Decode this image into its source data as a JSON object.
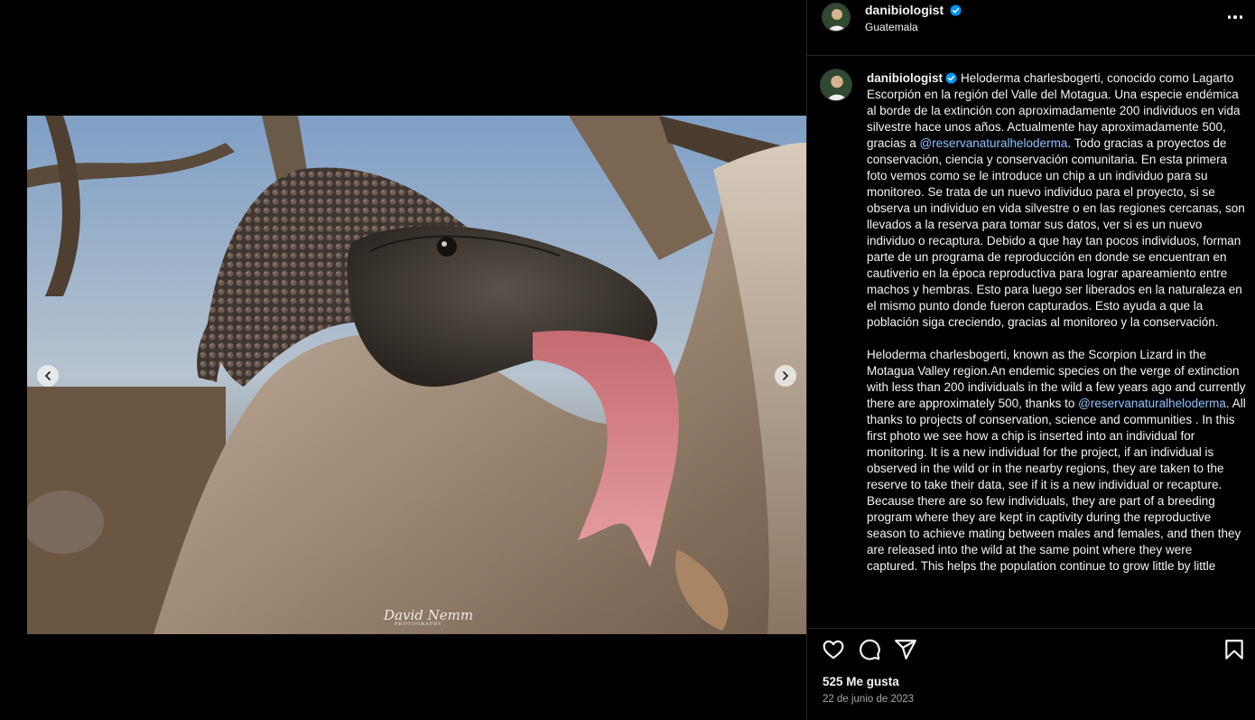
{
  "post": {
    "username": "danibiologist",
    "location": "Guatemala",
    "caption_es_1": "Heloderma charlesbogerti, conocido como Lagarto Escorpión en la región del Valle del Motagua. Una especie endémica al borde de la extinción con aproximadamente 200 individuos en vida silvestre hace unos años. Actualmente hay aproximadamente 500, gracias a ",
    "mention": "@reservanaturalheloderma",
    "caption_es_2": ". Todo gracias a proyectos de conservación, ciencia y conservación comunitaria. En esta primera foto vemos como se le introduce un chip a un individuo para su monitoreo. Se trata de un nuevo individuo para el proyecto, si se observa un individuo en vida silvestre o en las regiones cercanas, son llevados a la reserva para tomar sus datos, ver si es un nuevo individuo o recaptura. Debido a que hay tan pocos individuos, forman parte de un programa de reproducción en donde se encuentran en cautiverio en la época reproductiva para lograr apareamiento entre machos y hembras. Esto para luego ser liberados en la naturaleza en el mismo punto donde fueron capturados. Esto ayuda a que la población siga creciendo, gracias al monitoreo y la conservación.",
    "caption_en_1": "Heloderma charlesbogerti, known as the Scorpion Lizard in the Motagua Valley region.An endemic species on the verge of extinction with less than 200 individuals in the wild a few years ago and currently there are approximately 500, thanks to ",
    "caption_en_2": ". All thanks to projects of conservation, science and communities . In this first photo we see how a chip is inserted into an individual for monitoring. It is a new individual for the project, if an individual is observed in the wild or in the nearby regions, they are taken to the reserve to take their data, see if it is a new individual or recapture. Because there are so few individuals, they are part of a breeding program where they are kept in captivity during the reproductive season to achieve mating between males and females, and then they are released into the wild at the same point where they were captured. This helps the population continue to grow little by little",
    "likes": "525 Me gusta",
    "date": "22 de junio de 2023",
    "watermark": "David Nemm",
    "watermark_sub": "PHOTOGRAPHY"
  },
  "icons": {
    "verified": "verified-badge-icon",
    "more": "more-options-icon",
    "like": "heart-icon",
    "comment": "comment-icon",
    "share": "share-icon",
    "save": "bookmark-icon",
    "prev": "chevron-left-icon",
    "next": "chevron-right-icon"
  },
  "colors": {
    "background": "#000000",
    "text": "#f5f5f5",
    "muted": "#a8a8a8",
    "mention": "#8ec3ff",
    "verified": "#0095f6",
    "divider": "#262626"
  }
}
